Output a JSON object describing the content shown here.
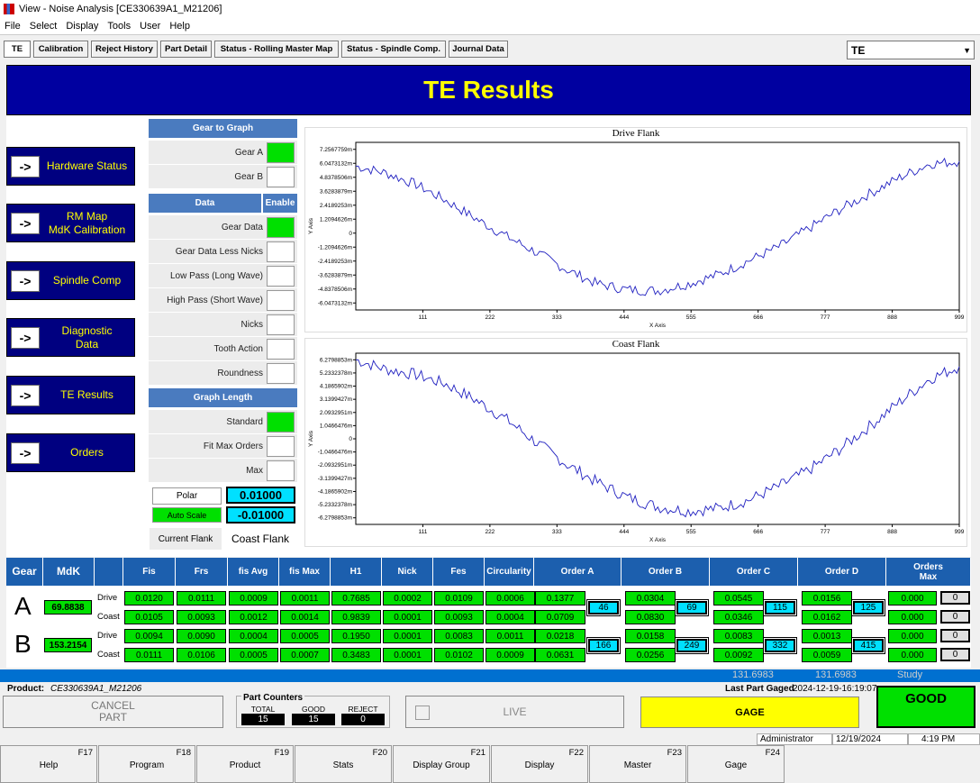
{
  "window": {
    "title": "View - Noise Analysis [CE330639A1_M21206]"
  },
  "menu": [
    "File",
    "Select",
    "Display",
    "Tools",
    "User",
    "Help"
  ],
  "tabs": [
    "TE",
    "Calibration",
    "Reject History",
    "Part Detail",
    "Status - Rolling Master Map",
    "Status - Spindle Comp.",
    "Journal Data"
  ],
  "view_select": "TE",
  "header_title": "TE Results",
  "nav": [
    {
      "arrow": "->",
      "label": "Hardware Status"
    },
    {
      "arrow": "->",
      "label": "RM Map\nMdK Calibration"
    },
    {
      "arrow": "->",
      "label": "Spindle Comp"
    },
    {
      "arrow": "->",
      "label": "Diagnostic\nData"
    },
    {
      "arrow": "->",
      "label": "TE Results"
    },
    {
      "arrow": "->",
      "label": "Orders"
    }
  ],
  "gear_to_graph": {
    "header": "Gear to Graph",
    "items": [
      {
        "label": "Gear A",
        "on": true
      },
      {
        "label": "Gear B",
        "on": false
      }
    ]
  },
  "data_section": {
    "header": "Data",
    "enable_header": "Enable",
    "items": [
      {
        "label": "Gear Data",
        "on": true
      },
      {
        "label": "Gear Data Less Nicks",
        "on": false
      },
      {
        "label": "Low Pass (Long Wave)",
        "on": false
      },
      {
        "label": "High Pass (Short Wave)",
        "on": false
      },
      {
        "label": "Nicks",
        "on": false
      },
      {
        "label": "Tooth Action",
        "on": false
      },
      {
        "label": "Roundness",
        "on": false
      }
    ]
  },
  "graph_length": {
    "header": "Graph Length",
    "items": [
      {
        "label": "Standard",
        "on": true
      },
      {
        "label": "Fit Max Orders",
        "on": false
      },
      {
        "label": "Max",
        "on": false
      }
    ]
  },
  "polar": {
    "label": "Polar",
    "value": "0.01000"
  },
  "autoscale": {
    "label": "Auto Scale",
    "value": "-0.01000"
  },
  "current_flank": {
    "label": "Current Flank",
    "value": "Coast Flank"
  },
  "chart_data": [
    {
      "type": "line",
      "title": "Drive Flank",
      "xlabel": "X Axis",
      "ylabel": "Y Axis",
      "xlim": [
        0,
        999
      ],
      "x_ticks": [
        "111",
        "222",
        "333",
        "444",
        "555",
        "666",
        "777",
        "888",
        "999"
      ],
      "y_ticks": [
        "7.2567759m",
        "6.0473132m",
        "4.8378506m",
        "3.6283879m",
        "2.4189253m",
        "1.2094626m",
        "0",
        "-1.2094626m",
        "-2.4189253m",
        "-3.6283879m",
        "-4.8378506m",
        "-6.0473132m"
      ],
      "ylim": [
        -7.2567759,
        7.2567759
      ],
      "color": "#2020c0",
      "series": [
        {
          "x": [
            0,
            50,
            100,
            150,
            200,
            250,
            300,
            350,
            400,
            450,
            500,
            550,
            600,
            650,
            700,
            750,
            800,
            850,
            900,
            950,
            999
          ],
          "y": [
            5.2,
            4.6,
            3.6,
            2.2,
            0.6,
            -0.9,
            -2.3,
            -3.8,
            -5.0,
            -5.5,
            -5.6,
            -5.0,
            -4.2,
            -3.0,
            -1.8,
            -0.2,
            1.4,
            2.8,
            4.2,
            5.4,
            5.6
          ]
        }
      ]
    },
    {
      "type": "line",
      "title": "Coast Flank",
      "xlabel": "X Axis",
      "ylabel": "Y Axis",
      "xlim": [
        0,
        999
      ],
      "x_ticks": [
        "111",
        "222",
        "333",
        "444",
        "555",
        "666",
        "777",
        "888",
        "999"
      ],
      "y_ticks": [
        "6.2798853m",
        "5.2332378m",
        "4.1865902m",
        "3.1399427m",
        "2.0932951m",
        "1.0466476m",
        "0",
        "-1.0466476m",
        "-2.0932951m",
        "-3.1399427m",
        "-4.1865902m",
        "-5.2332378m",
        "-6.2798853m"
      ],
      "ylim": [
        -6.2798853,
        6.2798853
      ],
      "color": "#2020c0",
      "series": [
        {
          "x": [
            0,
            50,
            100,
            150,
            200,
            250,
            300,
            350,
            400,
            450,
            500,
            550,
            600,
            650,
            700,
            750,
            800,
            850,
            900,
            950,
            999
          ],
          "y": [
            5.8,
            5.1,
            4.7,
            4.0,
            2.8,
            1.4,
            -0.3,
            -1.9,
            -3.2,
            -4.3,
            -5.0,
            -5.3,
            -5.1,
            -4.5,
            -3.5,
            -2.3,
            -0.8,
            0.9,
            2.7,
            4.4,
            5.3
          ]
        }
      ]
    }
  ],
  "grid": {
    "headers": [
      "Gear",
      "MdK",
      "",
      "Fis",
      "Frs",
      "fis Avg",
      "fis Max",
      "H1",
      "Nick",
      "Fes",
      "Circularity",
      "Order A",
      "Order B",
      "Order C",
      "Order D",
      "Orders\nMax"
    ],
    "gears": [
      {
        "name": "A",
        "mdk": "69.8838",
        "rows": [
          {
            "flank": "Drive",
            "values": [
              "0.0120",
              "0.0111",
              "0.0009",
              "0.0011",
              "0.7685",
              "0.0002",
              "0.0109",
              "0.0006"
            ],
            "orders": [
              "0.1377",
              "0.0304",
              "0.0545",
              "0.0156"
            ],
            "max": "0.000",
            "gray": "0"
          },
          {
            "flank": "Coast",
            "values": [
              "0.0105",
              "0.0093",
              "0.0012",
              "0.0014",
              "0.9839",
              "0.0001",
              "0.0093",
              "0.0004"
            ],
            "orders": [
              "0.0709",
              "0.0830",
              "0.0346",
              "0.0162"
            ],
            "max": "0.000",
            "gray": "0"
          }
        ],
        "order_nums": [
          "46",
          "69",
          "115",
          "125"
        ]
      },
      {
        "name": "B",
        "mdk": "153.2154",
        "rows": [
          {
            "flank": "Drive",
            "values": [
              "0.0094",
              "0.0090",
              "0.0004",
              "0.0005",
              "0.1950",
              "0.0001",
              "0.0083",
              "0.0011"
            ],
            "orders": [
              "0.0218",
              "0.0158",
              "0.0083",
              "0.0013"
            ],
            "max": "0.000",
            "gray": "0"
          },
          {
            "flank": "Coast",
            "values": [
              "0.0111",
              "0.0106",
              "0.0005",
              "0.0007",
              "0.3483",
              "0.0001",
              "0.0102",
              "0.0009"
            ],
            "orders": [
              "0.0631",
              "0.0256",
              "0.0092",
              "0.0059"
            ],
            "max": "0.000",
            "gray": "0"
          }
        ],
        "order_nums": [
          "166",
          "249",
          "332",
          "415"
        ]
      }
    ]
  },
  "statusbar": {
    "v1": "131.6983",
    "v2": "131.6983",
    "mode": "Study"
  },
  "product": {
    "label": "Product:",
    "value": "CE330639A1_M21206"
  },
  "last_gaged": {
    "label": "Last Part Gaged",
    "value": "2024-12-19-16:19:07"
  },
  "cancel": "CANCEL\nPART",
  "counters": {
    "title": "Part Counters",
    "total_label": "TOTAL",
    "total": "15",
    "good_label": "GOOD",
    "good": "15",
    "reject_label": "REJECT",
    "reject": "0"
  },
  "live": "LIVE",
  "gage": "GAGE",
  "result": "GOOD",
  "info": {
    "user": "Administrator",
    "date": "12/19/2024",
    "time": "4:19 PM"
  },
  "fkeys": [
    {
      "key": "F17",
      "label": "Help"
    },
    {
      "key": "F18",
      "label": "Program"
    },
    {
      "key": "F19",
      "label": "Product"
    },
    {
      "key": "F20",
      "label": "Stats"
    },
    {
      "key": "F21",
      "label": "Display Group"
    },
    {
      "key": "F22",
      "label": "Display"
    },
    {
      "key": "F23",
      "label": "Master"
    },
    {
      "key": "F24",
      "label": "Gage"
    }
  ],
  "colors": {
    "header_bg": "#0000a0",
    "header_text": "#ffff00",
    "grid_header": "#1c5fae",
    "green": "#00e000",
    "cyan": "#00e0ff",
    "yellow": "#ffff00"
  }
}
